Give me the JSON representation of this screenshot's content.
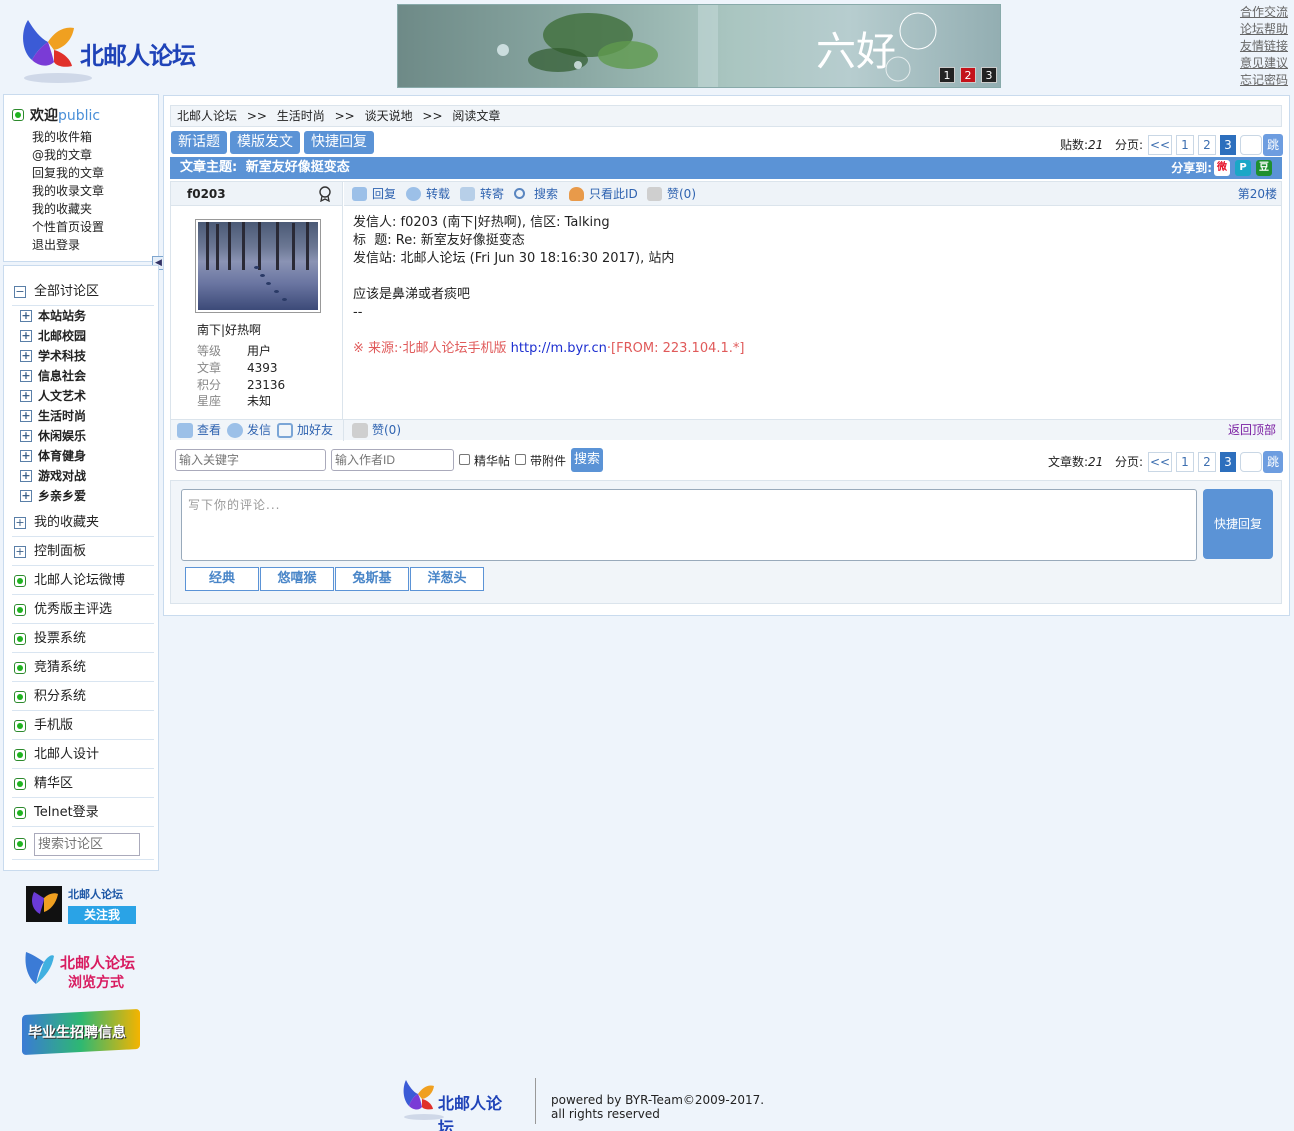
{
  "header": {
    "logo_text": "北邮人论坛",
    "banner": {
      "caption": "六好",
      "pages": [
        "1",
        "2",
        "3"
      ],
      "active_page": "2"
    },
    "links": [
      "合作交流",
      "论坛帮助",
      "友情链接",
      "意见建议",
      "忘记密码"
    ]
  },
  "userbox": {
    "welcome": "欢迎",
    "user": "public",
    "items": [
      "我的收件箱",
      "@我的文章",
      "回复我的文章",
      "我的收录文章",
      "我的收藏夹",
      "个性首页设置",
      "退出登录"
    ]
  },
  "nav": {
    "all_boards": "全部讨论区",
    "boards": [
      "本站站务",
      "北邮校园",
      "学术科技",
      "信息社会",
      "人文艺术",
      "生活时尚",
      "休闲娱乐",
      "体育健身",
      "游戏对战",
      "乡亲乡爱"
    ],
    "favorites": "我的收藏夹",
    "control": "控制面板",
    "links": [
      "北邮人论坛微博",
      "优秀版主评选",
      "投票系统",
      "竞猜系统",
      "积分系统",
      "手机版",
      "北邮人设计",
      "精华区",
      "Telnet登录"
    ],
    "search_placeholder": "搜索讨论区"
  },
  "promos": {
    "weibo_title": "北邮人论坛",
    "weibo_follow": "关注我",
    "browse_title": "北邮人论坛",
    "browse_sub": "浏览方式",
    "jobs": "毕业生招聘信息"
  },
  "breadcrumb": [
    "北邮人论坛",
    "生活时尚",
    "谈天说地",
    "阅读文章"
  ],
  "breadcrumb_sep": ">>",
  "toolbar": {
    "new_topic": "新话题",
    "template_post": "模版发文",
    "quick_reply": "快捷回复"
  },
  "pager_top": {
    "count_label": "贴数:",
    "count": "21",
    "page_label": "分页:",
    "prev": "<<",
    "pages": [
      "1",
      "2",
      "3"
    ],
    "current": "3",
    "go": "跳"
  },
  "thread": {
    "title_label": "文章主题:",
    "title": "新室友好像挺变态",
    "share_label": "分享到:"
  },
  "post": {
    "author": "f0203",
    "nickname": "南下|好热啊",
    "stats": [
      {
        "k": "等级",
        "v": "用户"
      },
      {
        "k": "文章",
        "v": "4393"
      },
      {
        "k": "积分",
        "v": "23136"
      },
      {
        "k": "星座",
        "v": "未知"
      }
    ],
    "tools": [
      "回复",
      "转载",
      "转寄",
      "搜索",
      "只看此ID",
      "赞(0)"
    ],
    "floor": "第20楼",
    "line1": "发信人: f0203 (南下|好热啊), 信区: Talking",
    "line2": "标  题: Re: 新室友好像挺变态",
    "line3": "发信站: 北邮人论坛 (Fri Jun 30 18:16:30 2017), 站内",
    "line4": "应该是鼻涕或者痰吧",
    "line5": "--",
    "source_prefix": "※ 来源:·北邮人论坛手机版 ",
    "source_link": "http://m.byr.cn",
    "source_suffix": "·[FROM: 223.104.1.*]",
    "foot_tools": [
      "查看",
      "发信",
      "加好友"
    ],
    "like": "赞(0)",
    "back_top": "返回顶部"
  },
  "search_bar": {
    "keyword_placeholder": "输入关键字",
    "author_placeholder": "输入作者ID",
    "digest": "精华帖",
    "attach": "带附件",
    "search": "搜索"
  },
  "pager_bottom": {
    "count_label": "文章数:",
    "count": "21",
    "page_label": "分页:",
    "prev": "<<",
    "pages": [
      "1",
      "2",
      "3"
    ],
    "current": "3",
    "go": "跳"
  },
  "reply": {
    "placeholder": "写下你的评论...",
    "button": "快捷回复",
    "emoticons": [
      "经典",
      "悠嘻猴",
      "兔斯基",
      "洋葱头"
    ]
  },
  "footer": {
    "line1": "powered by BYR-Team©2009-2017.",
    "line2": "all rights reserved"
  },
  "colors": {
    "accent": "#5b93d6",
    "link": "#1d57a6",
    "source_red": "#e05a5a"
  }
}
